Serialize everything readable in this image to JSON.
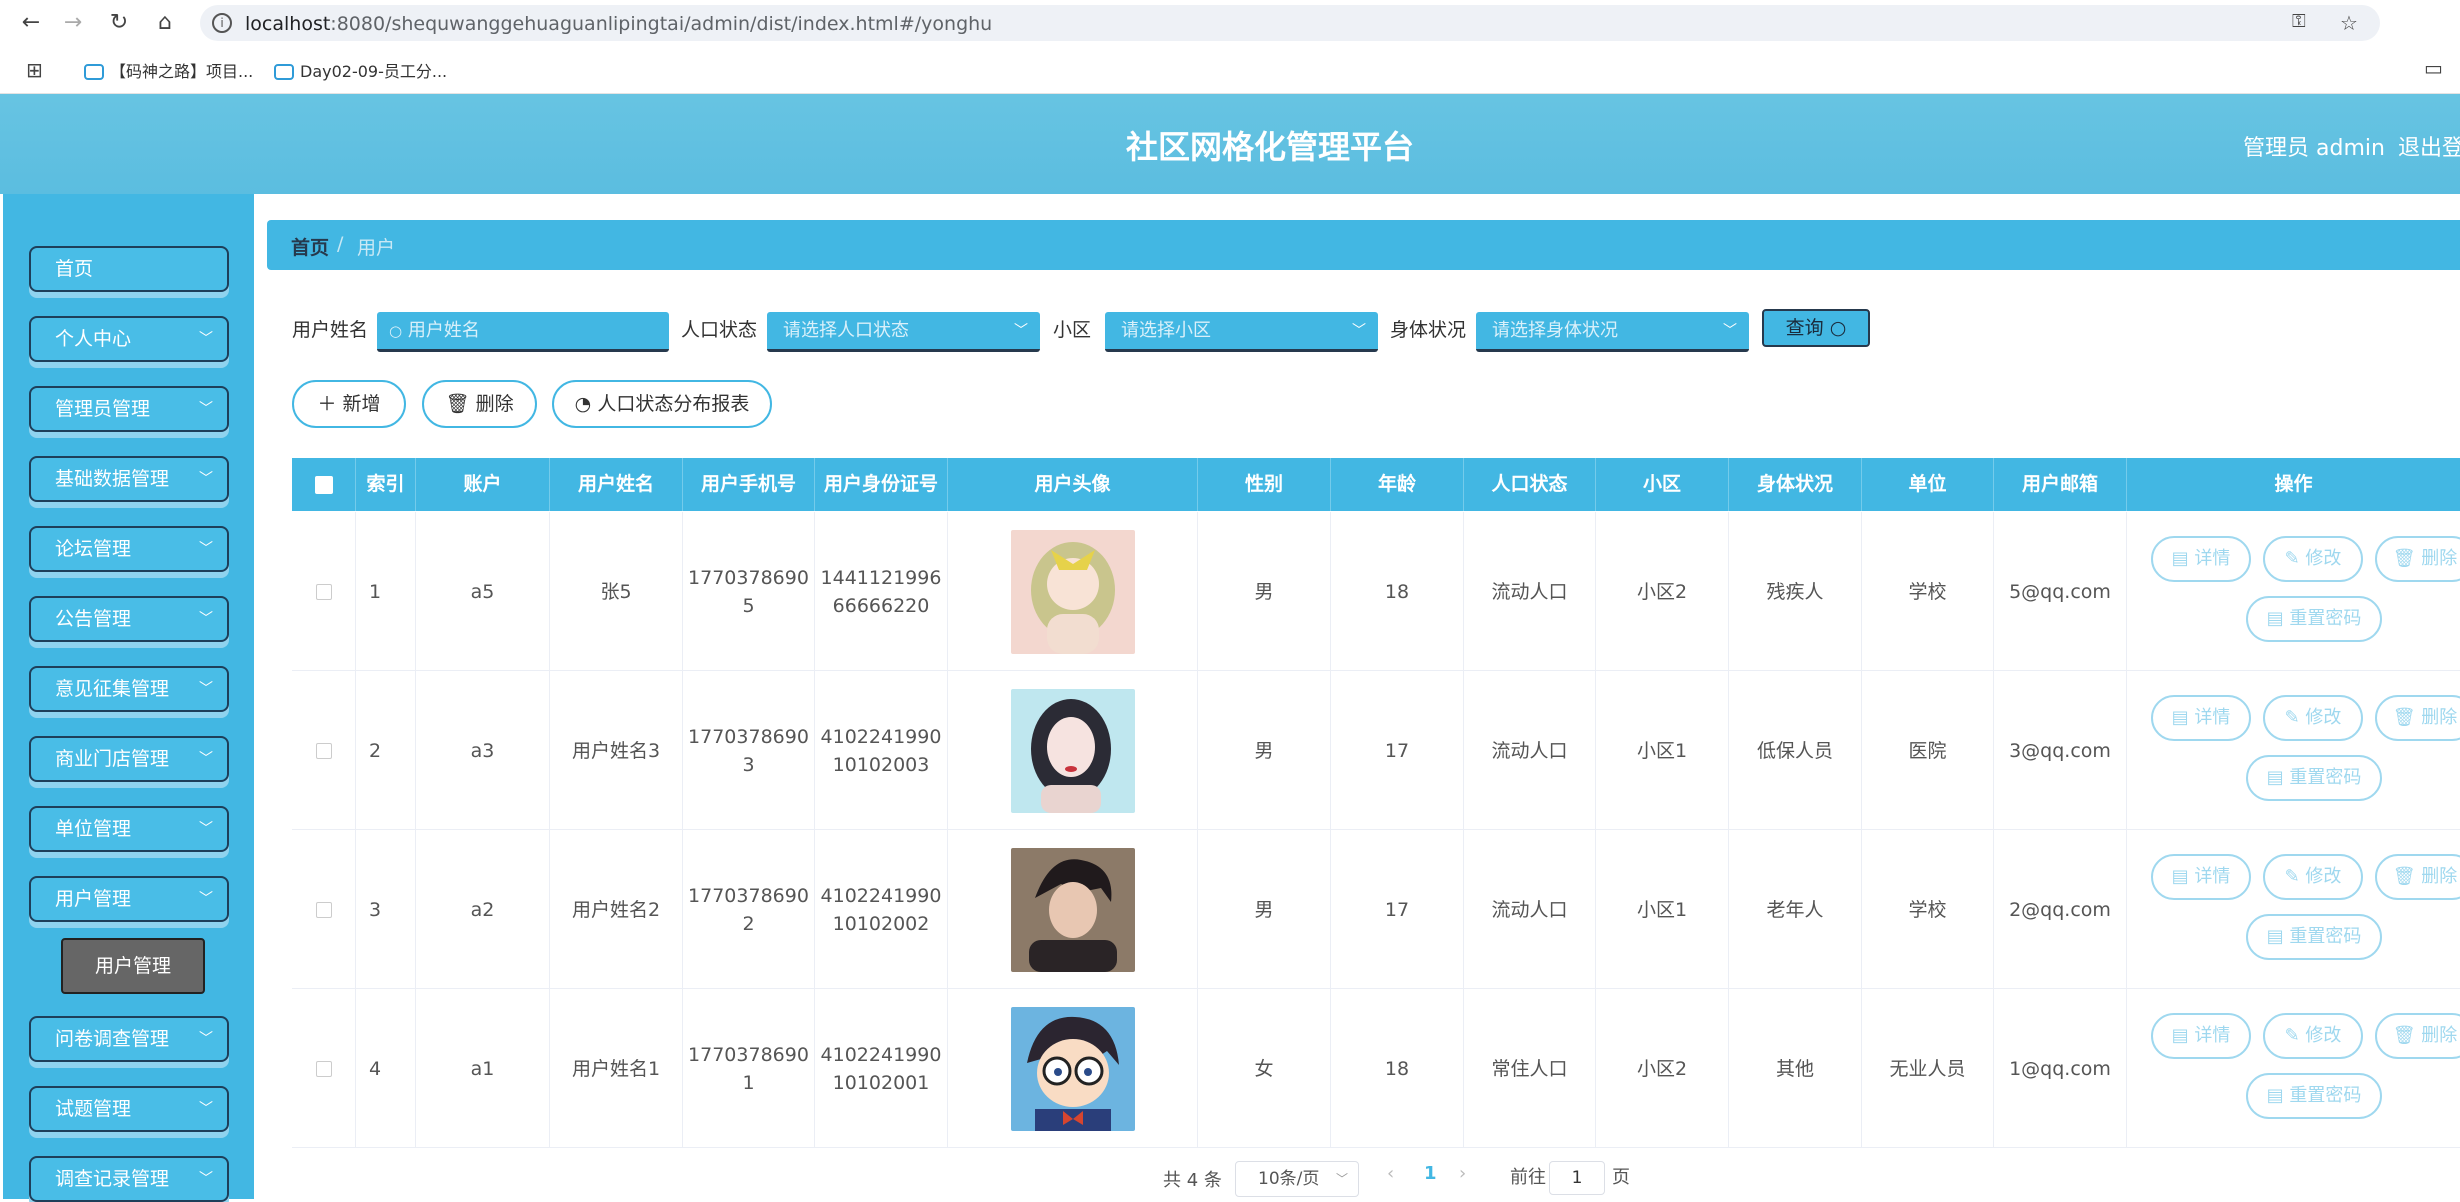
{
  "browser": {
    "url_host": "localhost",
    "url_path": ":8080/shequwanggehuaguanlipingtai/admin/dist/index.html#/yonghu",
    "bookmarks": [
      "【码神之路】项目...",
      "Day02-09-员工分..."
    ]
  },
  "header": {
    "title": "社区网格化管理平台",
    "admin": "管理员 admin",
    "logout": "退出登"
  },
  "sidebar": {
    "items": [
      "首页",
      "个人中心",
      "管理员管理",
      "基础数据管理",
      "论坛管理",
      "公告管理",
      "意见征集管理",
      "商业门店管理",
      "单位管理",
      "用户管理",
      "问卷调查管理",
      "试题管理",
      "调查记录管理"
    ],
    "submenu": "用户管理"
  },
  "breadcrumb": {
    "home": "首页",
    "sep": "/",
    "current": "用户"
  },
  "search": {
    "name_label": "用户姓名",
    "name_placeholder": "用户姓名",
    "status_label": "人口状态",
    "status_placeholder": "请选择人口状态",
    "district_label": "小区",
    "district_placeholder": "请选择小区",
    "health_label": "身体状况",
    "health_placeholder": "请选择身体状况",
    "query_label": "查询"
  },
  "actions": {
    "add": "新增",
    "delete": "删除",
    "report": "人口状态分布报表"
  },
  "table": {
    "headers": [
      "索引",
      "账户",
      "用户姓名",
      "用户手机号",
      "用户身份证号",
      "用户头像",
      "性别",
      "年龄",
      "人口状态",
      "小区",
      "身体状况",
      "单位",
      "用户邮箱",
      "操作"
    ],
    "rows": [
      {
        "index": "1",
        "account": "a5",
        "name": "张5",
        "phone": [
          "1770378690",
          "5"
        ],
        "idcard": [
          "1441121996",
          "66666220"
        ],
        "gender": "男",
        "age": "18",
        "status": "流动人口",
        "district": "小区2",
        "health": "残疾人",
        "unit": "学校",
        "email": "5@qq.com"
      },
      {
        "index": "2",
        "account": "a3",
        "name": "用户姓名3",
        "phone": [
          "1770378690",
          "3"
        ],
        "idcard": [
          "4102241990",
          "10102003"
        ],
        "gender": "男",
        "age": "17",
        "status": "流动人口",
        "district": "小区1",
        "health": "低保人员",
        "unit": "医院",
        "email": "3@qq.com"
      },
      {
        "index": "3",
        "account": "a2",
        "name": "用户姓名2",
        "phone": [
          "1770378690",
          "2"
        ],
        "idcard": [
          "4102241990",
          "10102002"
        ],
        "gender": "男",
        "age": "17",
        "status": "流动人口",
        "district": "小区1",
        "health": "老年人",
        "unit": "学校",
        "email": "2@qq.com"
      },
      {
        "index": "4",
        "account": "a1",
        "name": "用户姓名1",
        "phone": [
          "1770378690",
          "1"
        ],
        "idcard": [
          "4102241990",
          "10102001"
        ],
        "gender": "女",
        "age": "18",
        "status": "常住人口",
        "district": "小区2",
        "health": "其他",
        "unit": "无业人员",
        "email": "1@qq.com"
      }
    ],
    "ops": {
      "detail": "详情",
      "edit": "修改",
      "delete": "删除",
      "reset": "重置密码"
    }
  },
  "pager": {
    "total": "共 4 条",
    "size": "10条/页",
    "current": "1",
    "goto": "前往",
    "goto_value": "1",
    "page": "页"
  }
}
